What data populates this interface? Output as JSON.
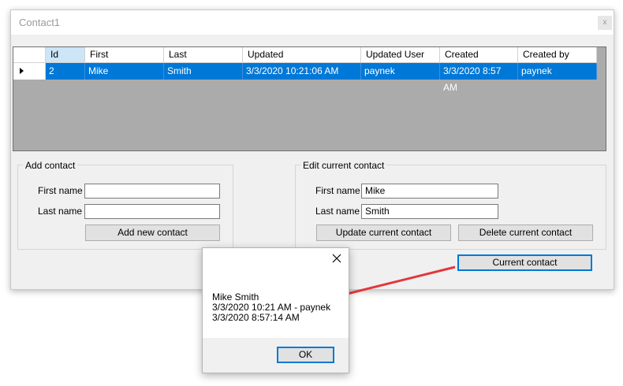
{
  "window": {
    "title": "Contact1",
    "close_glyph": "x"
  },
  "grid": {
    "columns": [
      "Id",
      "First",
      "Last",
      "Updated",
      "Updated User",
      "Created",
      "Created by"
    ],
    "rows": [
      [
        "2",
        "Mike",
        "Smith",
        "3/3/2020 10:21:06 AM",
        "paynek",
        "3/3/2020 8:57 AM",
        "paynek"
      ]
    ]
  },
  "add_contact": {
    "legend": "Add contact",
    "first_name_label": "First name",
    "last_name_label": "Last name",
    "first_name_value": "",
    "last_name_value": "",
    "add_button": "Add new contact"
  },
  "edit_contact": {
    "legend": "Edit current contact",
    "first_name_label": "First name",
    "last_name_label": "Last name",
    "first_name_value": "Mike",
    "last_name_value": "Smith",
    "update_button": "Update current contact",
    "delete_button": "Delete current contact"
  },
  "current_contact_button": "Current contact",
  "message_box": {
    "line1": "Mike Smith",
    "line2": "3/3/2020 10:21 AM - paynek",
    "line3": "3/3/2020 8:57:14 AM",
    "ok_button": "OK"
  },
  "colors": {
    "selection": "#0078d7",
    "header_selected": "#cce5f7",
    "grid_background": "#ababab",
    "annotation_arrow": "#e0393b"
  }
}
